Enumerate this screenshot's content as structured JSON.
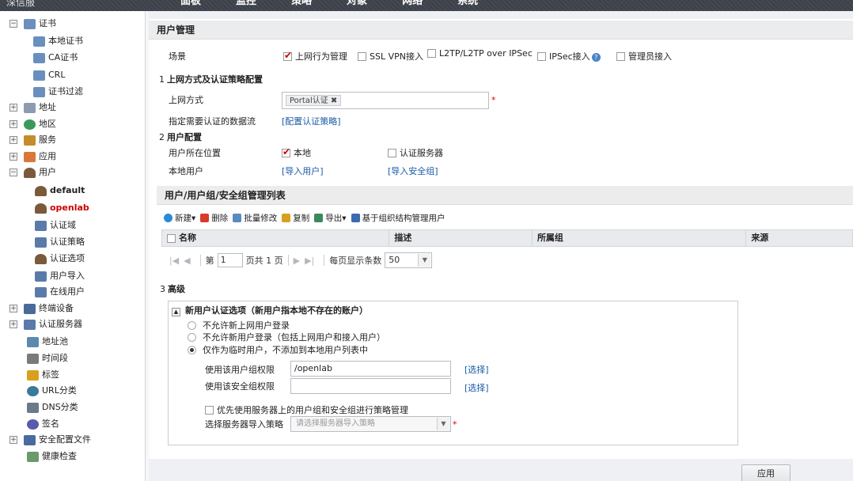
{
  "top_nav": [
    "面板",
    "监控",
    "策略",
    "对象",
    "网络",
    "系统"
  ],
  "brand": "深信服",
  "sidebar": {
    "items": [
      {
        "label": "证书",
        "expander": "−"
      },
      {
        "label": "本地证书"
      },
      {
        "label": "CA证书"
      },
      {
        "label": "CRL"
      },
      {
        "label": "证书过滤"
      },
      {
        "label": "地址",
        "expander": "+"
      },
      {
        "label": "地区",
        "expander": "+"
      },
      {
        "label": "服务",
        "expander": "+"
      },
      {
        "label": "应用",
        "expander": "+"
      },
      {
        "label": "用户",
        "expander": "−"
      },
      {
        "label": "default"
      },
      {
        "label": "openlab"
      },
      {
        "label": "认证域"
      },
      {
        "label": "认证策略"
      },
      {
        "label": "认证选项"
      },
      {
        "label": "用户导入"
      },
      {
        "label": "在线用户"
      },
      {
        "label": "终端设备",
        "expander": "+"
      },
      {
        "label": "认证服务器",
        "expander": "+"
      },
      {
        "label": "地址池"
      },
      {
        "label": "时间段"
      },
      {
        "label": "标签"
      },
      {
        "label": "URL分类"
      },
      {
        "label": "DNS分类"
      },
      {
        "label": "签名"
      },
      {
        "label": "安全配置文件",
        "expander": "+"
      },
      {
        "label": "健康检查"
      }
    ]
  },
  "user_mgmt": {
    "title": "用户管理",
    "scene_label": "场景",
    "scenes": [
      {
        "label": "上网行为管理",
        "checked": true
      },
      {
        "label": "SSL VPN接入",
        "checked": false
      },
      {
        "label": "L2TP/L2TP over IPSec",
        "checked": false
      },
      {
        "label": "IPSec接入",
        "checked": false
      },
      {
        "label": "管理员接入",
        "checked": false
      }
    ],
    "step1_num": "1",
    "step1_title": "上网方式及认证策略配置",
    "access_label": "上网方式",
    "access_tag": "Portal认证 ✖",
    "required_mark": "*",
    "flow_label": "指定需要认证的数据流",
    "flow_link": "[配置认证策略]",
    "step2_num": "2",
    "step2_title": "用户配置",
    "location_label": "用户所在位置",
    "loc_local": "本地",
    "loc_server": "认证服务器",
    "local_user_label": "本地用户",
    "import_user_link": "[导入用户]",
    "import_group_link": "[导入安全组]"
  },
  "list": {
    "title": "用户/用户组/安全组管理列表",
    "toolbar": [
      "新建▾",
      "删除",
      "批量修改",
      "复制",
      "导出▾",
      "基于组织结构管理用户"
    ],
    "columns": [
      "名称",
      "描述",
      "所属组",
      "来源"
    ],
    "pager_first": "|◀",
    "pager_prev": "◀",
    "pager_page_prefix": "第",
    "pager_page": "1",
    "pager_total": "页共 1 页",
    "pager_next": "▶",
    "pager_last": "▶|",
    "pager_size_label": "每页显示条数",
    "pager_size": "50"
  },
  "advanced": {
    "num": "3",
    "title": "高级",
    "collapse_icon": "▲",
    "group_title": "新用户认证选项（新用户指本地不存在的账户）",
    "options": [
      {
        "label": "不允许新上网用户登录",
        "selected": false
      },
      {
        "label": "不允许新用户登录（包括上网用户和接入用户）",
        "selected": false
      },
      {
        "label": "仅作为临时用户，不添加到本地用户列表中",
        "selected": true
      }
    ],
    "group_perm_label": "使用该用户组权限",
    "group_perm_value": "/openlab",
    "select_link": "[选择]",
    "sec_perm_label": "使用该安全组权限",
    "sec_perm_value": "",
    "prefer_label": "优先使用服务器上的用户组和安全组进行策略管理",
    "policy_label": "选择服务器导入策略",
    "policy_placeholder": "请选择服务器导入策略"
  },
  "apply_button": "应用"
}
